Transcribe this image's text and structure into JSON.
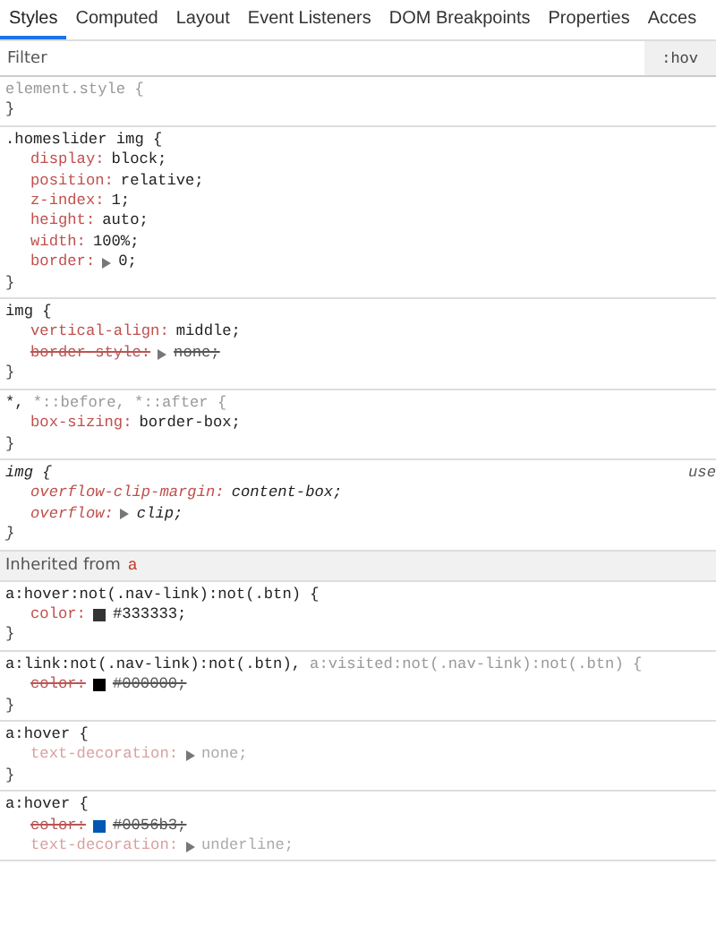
{
  "tabs": [
    {
      "label": "Styles",
      "selected": true
    },
    {
      "label": "Computed",
      "selected": false
    },
    {
      "label": "Layout",
      "selected": false
    },
    {
      "label": "Event Listeners",
      "selected": false
    },
    {
      "label": "DOM Breakpoints",
      "selected": false
    },
    {
      "label": "Properties",
      "selected": false
    },
    {
      "label": "Acces",
      "selected": false
    }
  ],
  "filter": {
    "placeholder": "Filter",
    "toggle": ":hov"
  },
  "panes": [
    {
      "kind": "rule",
      "user_agent": false,
      "selectors": [
        {
          "text": "element.style {",
          "matched": false
        }
      ],
      "close": "}"
    },
    {
      "kind": "rule",
      "user_agent": false,
      "selectors": [
        {
          "text": ".homeslider img {",
          "matched": true
        }
      ],
      "declarations": [
        {
          "name": "display:",
          "value": "block;",
          "overridden": false,
          "inactive": false,
          "expandable": false
        },
        {
          "name": "position:",
          "value": "relative;",
          "overridden": false,
          "inactive": false,
          "expandable": false
        },
        {
          "name": "z-index:",
          "value": "1;",
          "overridden": false,
          "inactive": false,
          "expandable": false
        },
        {
          "name": "height:",
          "value": "auto;",
          "overridden": false,
          "inactive": false,
          "expandable": false
        },
        {
          "name": "width:",
          "value": "100%;",
          "overridden": false,
          "inactive": false,
          "expandable": false
        },
        {
          "name": "border:",
          "value": "0;",
          "overridden": false,
          "inactive": false,
          "expandable": true
        }
      ],
      "close": "}"
    },
    {
      "kind": "rule",
      "user_agent": false,
      "selectors": [
        {
          "text": "img {",
          "matched": true
        }
      ],
      "declarations": [
        {
          "name": "vertical-align:",
          "value": "middle;",
          "overridden": false,
          "inactive": false,
          "expandable": false
        },
        {
          "name": "border-style:",
          "value": "none;",
          "overridden": true,
          "inactive": false,
          "expandable": true
        }
      ],
      "close": "}"
    },
    {
      "kind": "rule",
      "user_agent": false,
      "selectors": [
        {
          "text": "*,",
          "matched": true
        },
        {
          "text": "*::before, *::after {",
          "matched": false
        }
      ],
      "declarations": [
        {
          "name": "box-sizing:",
          "value": "border-box;",
          "overridden": false,
          "inactive": false,
          "expandable": false
        }
      ],
      "close": "}"
    },
    {
      "kind": "rule",
      "user_agent": true,
      "origin": "use",
      "selectors": [
        {
          "text": "img {",
          "matched": true
        }
      ],
      "declarations": [
        {
          "name": "overflow-clip-margin:",
          "value": "content-box;",
          "overridden": false,
          "inactive": false,
          "expandable": false
        },
        {
          "name": "overflow:",
          "value": "clip;",
          "overridden": false,
          "inactive": false,
          "expandable": true
        }
      ],
      "close": "}"
    },
    {
      "kind": "inherited",
      "label": "Inherited from",
      "element": "a"
    },
    {
      "kind": "rule",
      "user_agent": false,
      "selectors": [
        {
          "text": "a:hover:not(.nav-link):not(.btn) {",
          "matched": true
        }
      ],
      "declarations": [
        {
          "name": "color:",
          "value": "#333333;",
          "overridden": false,
          "inactive": false,
          "expandable": false,
          "color": "#333333"
        }
      ],
      "close": "}"
    },
    {
      "kind": "rule",
      "user_agent": false,
      "selectors": [
        {
          "text": "a:link:not(.nav-link):not(.btn),",
          "matched": true
        },
        {
          "text": "a:visited:not(.nav-link):not(.btn) {",
          "matched": false
        }
      ],
      "declarations": [
        {
          "name": "color:",
          "value": "#000000;",
          "overridden": true,
          "inactive": false,
          "expandable": false,
          "color": "#000000"
        }
      ],
      "close": "}"
    },
    {
      "kind": "rule",
      "user_agent": false,
      "selectors": [
        {
          "text": "a:hover {",
          "matched": true
        }
      ],
      "declarations": [
        {
          "name": "text-decoration:",
          "value": "none;",
          "overridden": false,
          "inactive": true,
          "expandable": true
        }
      ],
      "close": "}"
    },
    {
      "kind": "rule",
      "user_agent": false,
      "selectors": [
        {
          "text": "a:hover {",
          "matched": true
        }
      ],
      "declarations": [
        {
          "name": "color:",
          "value": "#0056b3;",
          "overridden": true,
          "inactive": false,
          "expandable": false,
          "color": "#0056b3"
        },
        {
          "name": "text-decoration:",
          "value": "underline;",
          "overridden": false,
          "inactive": true,
          "expandable": true
        }
      ]
    }
  ]
}
